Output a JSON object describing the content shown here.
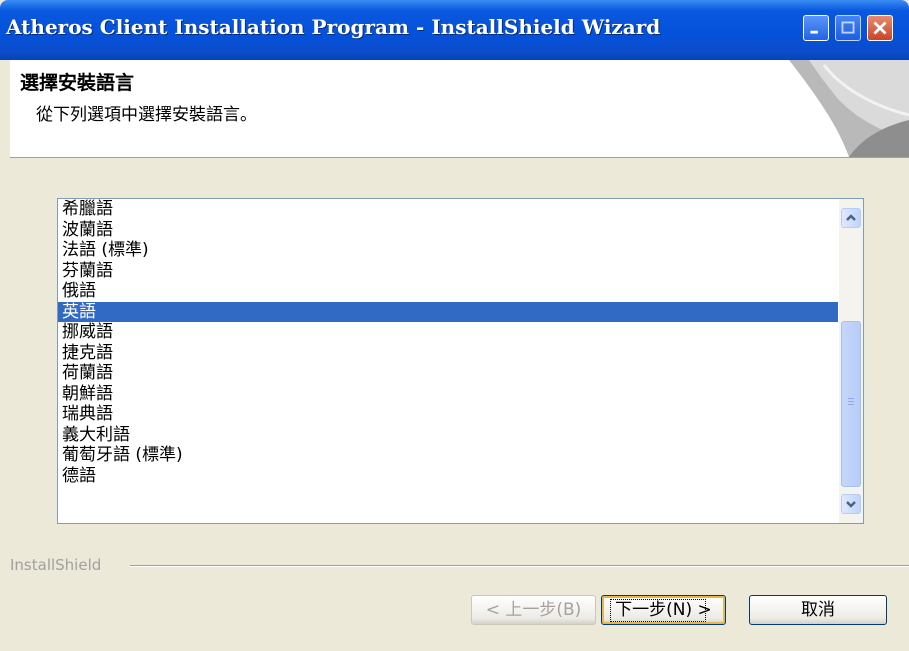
{
  "window": {
    "title": "Atheros Client Installation Program - InstallShield Wizard"
  },
  "header": {
    "title": "選擇安裝語言",
    "subtitle": "從下列選項中選擇安裝語言。"
  },
  "language_list": {
    "items": [
      "希臘語",
      "波蘭語",
      "法語 (標準)",
      "芬蘭語",
      "俄語",
      "英語",
      "挪威語",
      "捷克語",
      "荷蘭語",
      "朝鮮語",
      "瑞典語",
      "義大利語",
      "葡萄牙語 (標準)",
      "德語"
    ],
    "selected_index": 5,
    "scroll_position_fraction": 0.45
  },
  "brand": {
    "label": "InstallShield"
  },
  "buttons": {
    "back": "< 上一步(B)",
    "next": "下一步(N) >",
    "cancel": "取消"
  },
  "colors": {
    "titlebar": "#0551DA",
    "selection": "#316AC5",
    "face": "#ECE9D8"
  }
}
